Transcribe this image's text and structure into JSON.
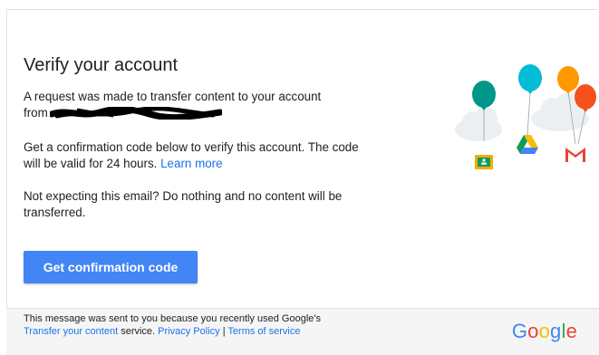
{
  "email": {
    "title": "Verify your account",
    "intro": "A request was made to transfer content to your account",
    "from_label": "from",
    "confirm_text": "Get a confirmation code below to verify this account. The code will be valid for 24 hours.",
    "learn_more": "Learn more",
    "not_expecting": "Not expecting this email? Do nothing and no content will be transferred.",
    "button_label": "Get confirmation code"
  },
  "footer": {
    "text_before": "This message was sent to you because you recently used Google's",
    "transfer_link": "Transfer your content",
    "text_after": "service.",
    "privacy_link": "Privacy Policy",
    "separator": "|",
    "terms_link": "Terms of service",
    "logo_letters": [
      "G",
      "o",
      "o",
      "g",
      "l",
      "e"
    ]
  },
  "colors": {
    "button": "#4285f4",
    "link": "#1a73e8",
    "balloon_teal": "#009688",
    "balloon_cyan": "#00bcd4",
    "balloon_orange": "#ff9800",
    "balloon_red": "#f4511e",
    "logo": [
      "#4285f4",
      "#ea4335",
      "#fbbc05",
      "#4285f4",
      "#34a853",
      "#ea4335"
    ]
  },
  "icons": [
    "classroom-icon",
    "drive-icon",
    "gmail-icon",
    "balloon-icon",
    "cloud-icon"
  ]
}
